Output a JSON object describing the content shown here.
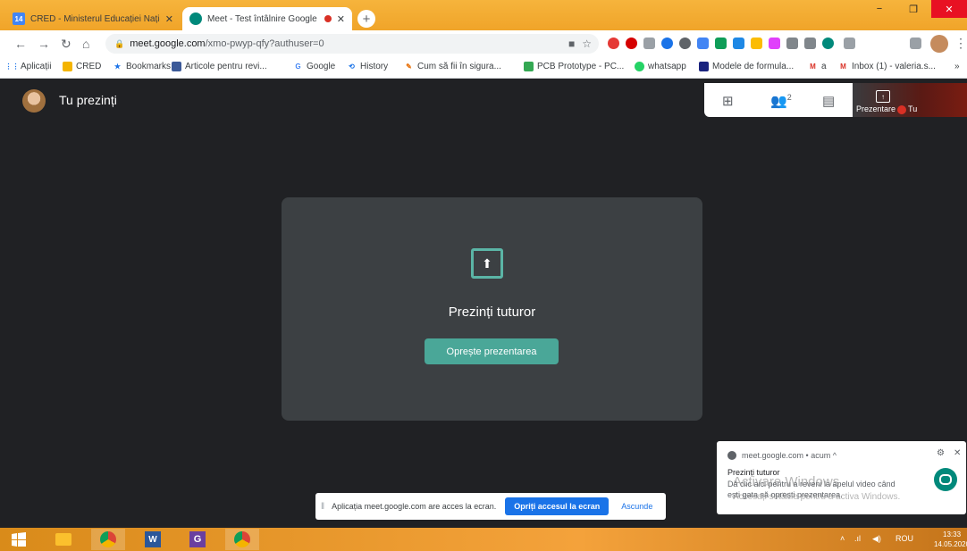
{
  "tabs": [
    {
      "title": "CRED - Ministerul Educației Naționale",
      "favicon": "calendar-14-icon",
      "badge": "14"
    },
    {
      "title": "Meet - Test întâlnire Google",
      "favicon": "meet-icon"
    }
  ],
  "window": {
    "minimize": "−",
    "maximize": "❐",
    "close": "✕"
  },
  "omnibox": {
    "host": "meet.google.com",
    "path": "/xmo-pwyp-qfy?authuser=0"
  },
  "bookmarks": [
    {
      "label": "Aplicații",
      "icon": "apps-grid-icon"
    },
    {
      "label": "CRED",
      "icon": "folder-icon"
    },
    {
      "label": "Bookmarks",
      "icon": "star-icon"
    },
    {
      "label": "Articole pentru revi...",
      "icon": "page-icon"
    },
    {
      "label": "Google",
      "icon": "google-g-icon"
    },
    {
      "label": "History",
      "icon": "history-icon"
    },
    {
      "label": "Cum să fii în sigura...",
      "icon": "page-icon"
    },
    {
      "label": "PCB Prototype - PC...",
      "icon": "pcb-icon"
    },
    {
      "label": "whatsapp",
      "icon": "whatsapp-icon"
    },
    {
      "label": "Modele de formula...",
      "icon": "page-icon"
    },
    {
      "label": "a",
      "icon": "gmail-icon"
    },
    {
      "label": "Inbox (1) - valeria.s...",
      "icon": "gmail-icon"
    }
  ],
  "meet": {
    "presenting_label": "Tu prezinți",
    "participants_count": "2",
    "thumbnail_label": "Prezentare",
    "thumbnail_self": "Tu",
    "card_message": "Prezinți tuturor",
    "stop_button": "Oprește prezentarea"
  },
  "sharebar": {
    "text": "Aplicația meet.google.com are acces la ecran.",
    "stop": "Opriți accesul la ecran",
    "hide": "Ascunde"
  },
  "notification": {
    "source": "meet.google.com • acum ^",
    "title": "Prezinți tuturor",
    "body": "Dă clic aici pentru a reveni la apelul video când ești gata să oprești prezentarea."
  },
  "watermark": {
    "line1": "Activare Windows",
    "line2": "Accesați setările pentru a activa Windows."
  },
  "taskbar": {
    "lang": "ROU",
    "time": "13:33",
    "date": "14.05.2020"
  }
}
